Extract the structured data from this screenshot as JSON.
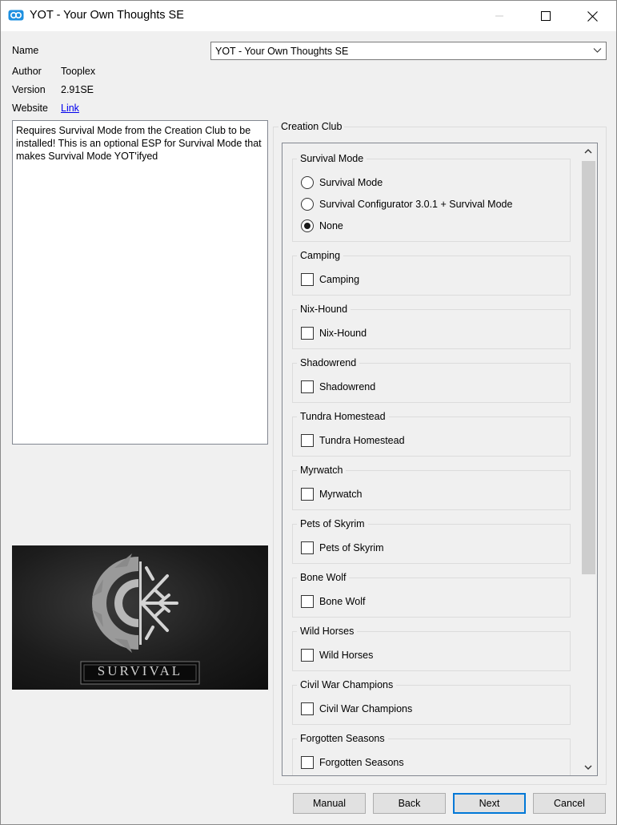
{
  "window": {
    "title": "YOT - Your Own Thoughts SE"
  },
  "fields": {
    "name_label": "Name",
    "name_value": "YOT - Your Own Thoughts SE",
    "author_label": "Author",
    "author_value": "Tooplex",
    "version_label": "Version",
    "version_value": "2.91SE",
    "website_label": "Website",
    "website_link": "Link"
  },
  "description": "Requires Survival Mode from the Creation Club to be installed! This is an optional ESP for Survival Mode that makes Survival Mode YOT'ifyed",
  "image": {
    "caption": "SURVIVAL"
  },
  "creation_club": {
    "title": "Creation Club",
    "groups": [
      {
        "title": "Survival Mode",
        "type": "radio",
        "options": [
          {
            "label": "Survival Mode",
            "selected": false
          },
          {
            "label": "Survival Configurator 3.0.1 + Survival Mode",
            "selected": false
          },
          {
            "label": "None",
            "selected": true
          }
        ]
      },
      {
        "title": "Camping",
        "type": "checkbox",
        "options": [
          {
            "label": "Camping",
            "checked": false
          }
        ]
      },
      {
        "title": "Nix-Hound",
        "type": "checkbox",
        "options": [
          {
            "label": "Nix-Hound",
            "checked": false
          }
        ]
      },
      {
        "title": "Shadowrend",
        "type": "checkbox",
        "options": [
          {
            "label": "Shadowrend",
            "checked": false
          }
        ]
      },
      {
        "title": "Tundra Homestead",
        "type": "checkbox",
        "options": [
          {
            "label": "Tundra Homestead",
            "checked": false
          }
        ]
      },
      {
        "title": "Myrwatch",
        "type": "checkbox",
        "options": [
          {
            "label": "Myrwatch",
            "checked": false
          }
        ]
      },
      {
        "title": "Pets of Skyrim",
        "type": "checkbox",
        "options": [
          {
            "label": "Pets of Skyrim",
            "checked": false
          }
        ]
      },
      {
        "title": "Bone Wolf",
        "type": "checkbox",
        "options": [
          {
            "label": "Bone Wolf",
            "checked": false
          }
        ]
      },
      {
        "title": "Wild Horses",
        "type": "checkbox",
        "options": [
          {
            "label": "Wild Horses",
            "checked": false
          }
        ]
      },
      {
        "title": "Civil War Champions",
        "type": "checkbox",
        "options": [
          {
            "label": "Civil War Champions",
            "checked": false
          }
        ]
      },
      {
        "title": "Forgotten Seasons",
        "type": "checkbox",
        "options": [
          {
            "label": "Forgotten Seasons",
            "checked": false
          }
        ]
      }
    ]
  },
  "buttons": {
    "manual": "Manual",
    "back": "Back",
    "next": "Next",
    "cancel": "Cancel"
  },
  "colors": {
    "accent": "#0078d7",
    "link": "#0000ee"
  }
}
